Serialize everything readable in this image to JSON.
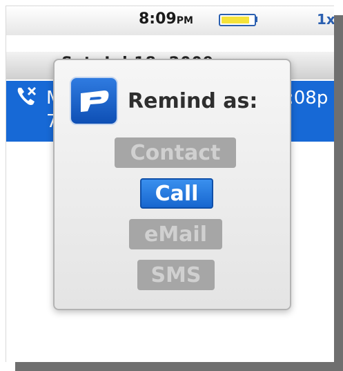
{
  "status_bar": {
    "time": "8:09",
    "ampm": "PM",
    "network": "1x",
    "battery_level": 0.88
  },
  "date_header": "Sat, Jul 18, 2009",
  "selected_entry": {
    "title": "M",
    "time": ":08p",
    "line2": "7"
  },
  "dialog": {
    "title": "Remind as:",
    "options": [
      {
        "label": "Contact",
        "state": "disabled"
      },
      {
        "label": "Call",
        "state": "selected"
      },
      {
        "label": "eMail",
        "state": "disabled"
      },
      {
        "label": "SMS",
        "state": "disabled"
      }
    ]
  },
  "colors": {
    "selection_blue": "#1769d6",
    "battery_fill": "#f5e23a",
    "accent": "#2a5fb0"
  }
}
